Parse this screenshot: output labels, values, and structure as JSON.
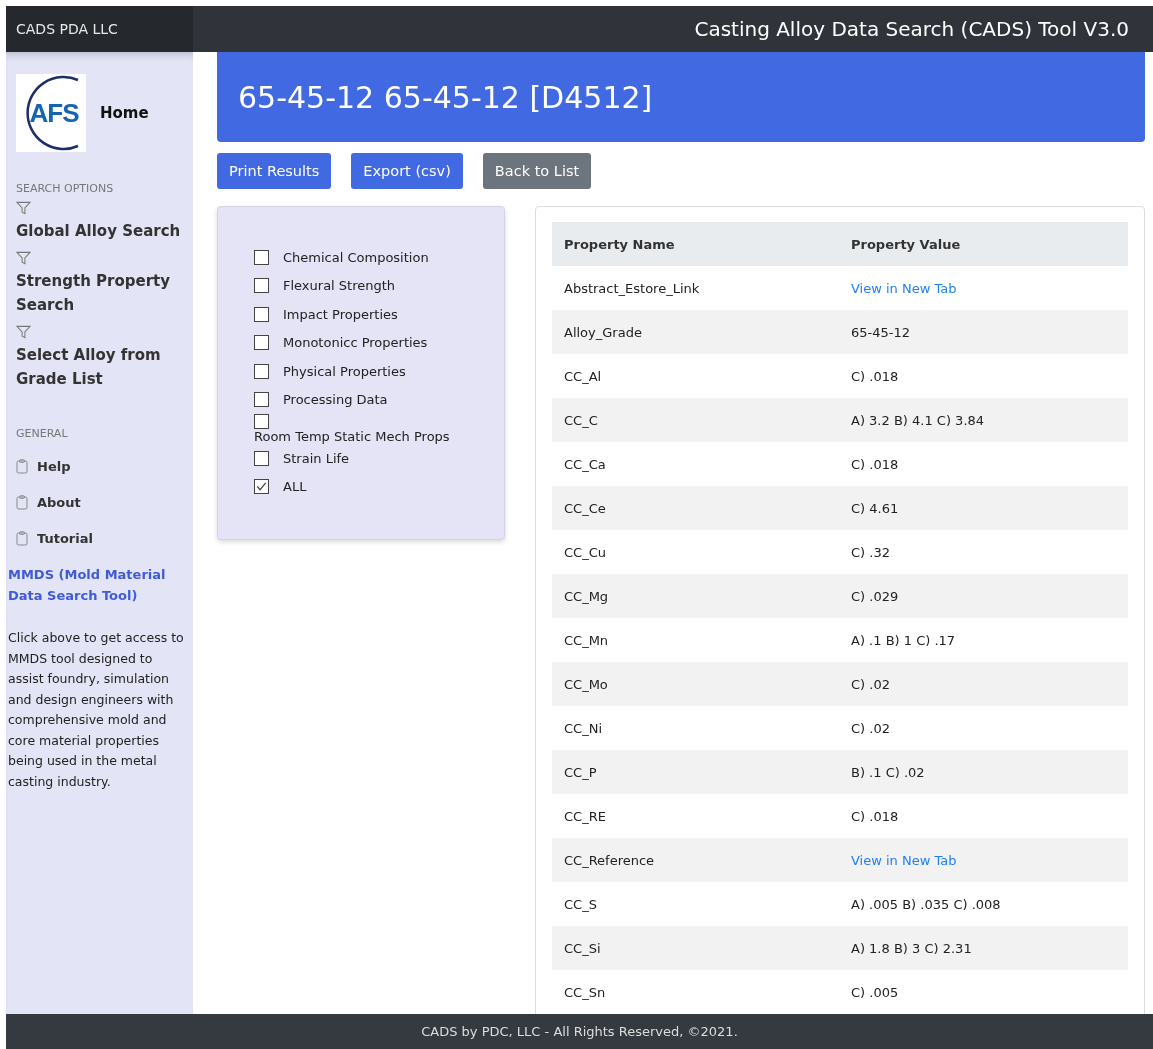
{
  "top_bar": {
    "brand": "CADS PDA LLC",
    "title": "Casting Alloy Data Search (CADS) Tool V3.0"
  },
  "sidebar": {
    "logo": "AFS",
    "home": "Home",
    "sections": [
      {
        "heading": "SEARCH OPTIONS",
        "kind": "filter",
        "items": [
          "Global Alloy Search",
          "Strength Property Search",
          "Select Alloy from Grade List"
        ]
      },
      {
        "heading": "GENERAL",
        "kind": "clipboard",
        "items": [
          "Help",
          "About",
          "Tutorial"
        ]
      }
    ],
    "promo_link": "MMDS (Mold Material Data Search Tool)",
    "promo_text": "Click above to get access to MMDS tool designed to assist foundry, simulation and design engineers with comprehensive mold and core material properties being used in the metal casting industry."
  },
  "banner": {
    "title": "65-45-12 65-45-12 [D4512]"
  },
  "buttons": [
    {
      "label": "Print Results",
      "kind": "primary"
    },
    {
      "label": "Export (csv)",
      "kind": "primary"
    },
    {
      "label": "Back to List",
      "kind": "secondary"
    }
  ],
  "filters": [
    {
      "label": "Chemical Composition",
      "checked": false
    },
    {
      "label": "Flexural Strength",
      "checked": false
    },
    {
      "label": "Impact Properties",
      "checked": false
    },
    {
      "label": "Monotonicc Properties",
      "checked": false
    },
    {
      "label": "Physical Properties",
      "checked": false
    },
    {
      "label": "Processing Data",
      "checked": false
    },
    {
      "label": "Room Temp Static Mech Props",
      "checked": false
    },
    {
      "label": "Strain Life",
      "checked": false
    },
    {
      "label": "ALL",
      "checked": true
    }
  ],
  "table": {
    "columns": [
      "Property Name",
      "Property Value"
    ],
    "rows": [
      {
        "name": "Abstract_Estore_Link",
        "value": "View in New Tab",
        "kind": "link"
      },
      {
        "name": "Alloy_Grade",
        "value": "65-45-12",
        "kind": "text"
      },
      {
        "name": "CC_Al",
        "value": "C) .018",
        "kind": "text"
      },
      {
        "name": "CC_C",
        "value": "A) 3.2 B) 4.1 C) 3.84",
        "kind": "text"
      },
      {
        "name": "CC_Ca",
        "value": "C) .018",
        "kind": "text"
      },
      {
        "name": "CC_Ce",
        "value": "C) 4.61",
        "kind": "text"
      },
      {
        "name": "CC_Cu",
        "value": "C) .32",
        "kind": "text"
      },
      {
        "name": "CC_Mg",
        "value": "C) .029",
        "kind": "text"
      },
      {
        "name": "CC_Mn",
        "value": "A) .1 B) 1 C) .17",
        "kind": "text"
      },
      {
        "name": "CC_Mo",
        "value": "C) .02",
        "kind": "text"
      },
      {
        "name": "CC_Ni",
        "value": "C) .02",
        "kind": "text"
      },
      {
        "name": "CC_P",
        "value": "B) .1 C) .02",
        "kind": "text"
      },
      {
        "name": "CC_RE",
        "value": "C) .018",
        "kind": "text"
      },
      {
        "name": "CC_Reference",
        "value": "View in New Tab",
        "kind": "link"
      },
      {
        "name": "CC_S",
        "value": "A) .005 B) .035 C) .008",
        "kind": "text"
      },
      {
        "name": "CC_Si",
        "value": "A) 1.8 B) 3 C) 2.31",
        "kind": "text"
      },
      {
        "name": "CC_Sn",
        "value": "C) .005",
        "kind": "text"
      }
    ]
  },
  "footer": "CADS by PDC, LLC - All Rights Reserved, ©2021."
}
